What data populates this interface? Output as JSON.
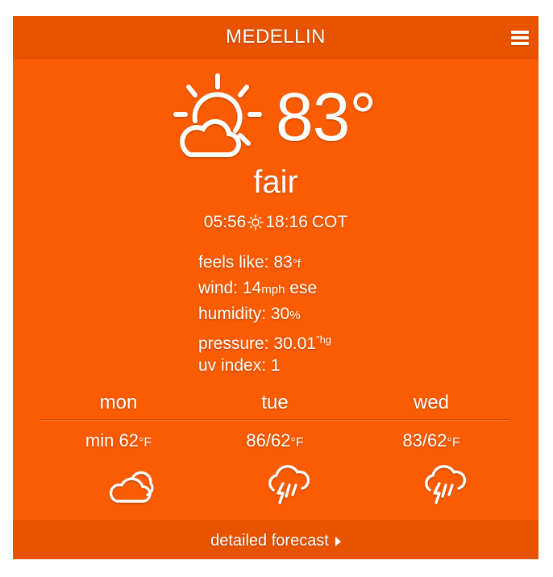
{
  "header": {
    "city": "MEDELLIN",
    "menu_icon": "hamburger-menu-icon"
  },
  "current": {
    "icon": "partly-cloudy-day-icon",
    "temperature": "83°",
    "condition": "fair",
    "sunrise": "05:56",
    "sunset": "18:16",
    "timezone": "COT",
    "feels_like_label": "feels like:",
    "feels_like_value": "83",
    "feels_like_unit": "°f",
    "wind_label": "wind:",
    "wind_speed": "14",
    "wind_unit": "mph",
    "wind_dir": "ese",
    "humidity_label": "humidity:",
    "humidity_value": "30",
    "humidity_unit": "%",
    "pressure_label": "pressure:",
    "pressure_value": "30.01",
    "pressure_unit": "\"hg",
    "uv_label": "uv index:",
    "uv_value": "1"
  },
  "forecast": [
    {
      "day": "mon",
      "temps": "min 62",
      "unit": "°F",
      "icon": "cloudy-icon"
    },
    {
      "day": "tue",
      "temps": "86/62",
      "unit": "°F",
      "icon": "thunderstorm-icon"
    },
    {
      "day": "wed",
      "temps": "83/62",
      "unit": "°F",
      "icon": "thunderstorm-icon"
    }
  ],
  "footer": {
    "label": "detailed forecast",
    "arrow_icon": "caret-right-icon"
  },
  "colors": {
    "background": "#fb5c01",
    "bar": "#e85300",
    "text": "#ffffff"
  }
}
